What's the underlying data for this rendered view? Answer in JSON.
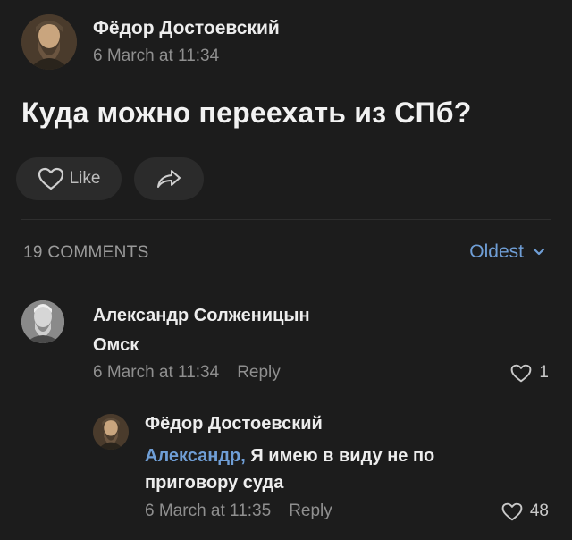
{
  "post": {
    "author": "Фёдор Достоевский",
    "timestamp": "6 March at 11:34",
    "title": "Куда можно переехать из СПб?",
    "like_label": "Like"
  },
  "comments_header": {
    "count_label": "19 COMMENTS",
    "sort_label": "Oldest"
  },
  "comments": [
    {
      "author": "Александр Солженицын",
      "text": "Омск",
      "timestamp": "6 March at 11:34",
      "reply_label": "Reply",
      "likes": "1"
    },
    {
      "author": "Фёдор Достоевский",
      "mention": "Александр,",
      "text_line1": "Я имею в виду не по",
      "text_line2": "приговору суда",
      "timestamp": "6 March at 11:35",
      "reply_label": "Reply",
      "likes": "48"
    }
  ],
  "icons": {
    "like": "heart-outline-icon",
    "share": "share-arrow-icon",
    "sort": "chevron-down-icon"
  },
  "colors": {
    "background": "#1c1c1c",
    "accent": "#6f9ed6"
  }
}
